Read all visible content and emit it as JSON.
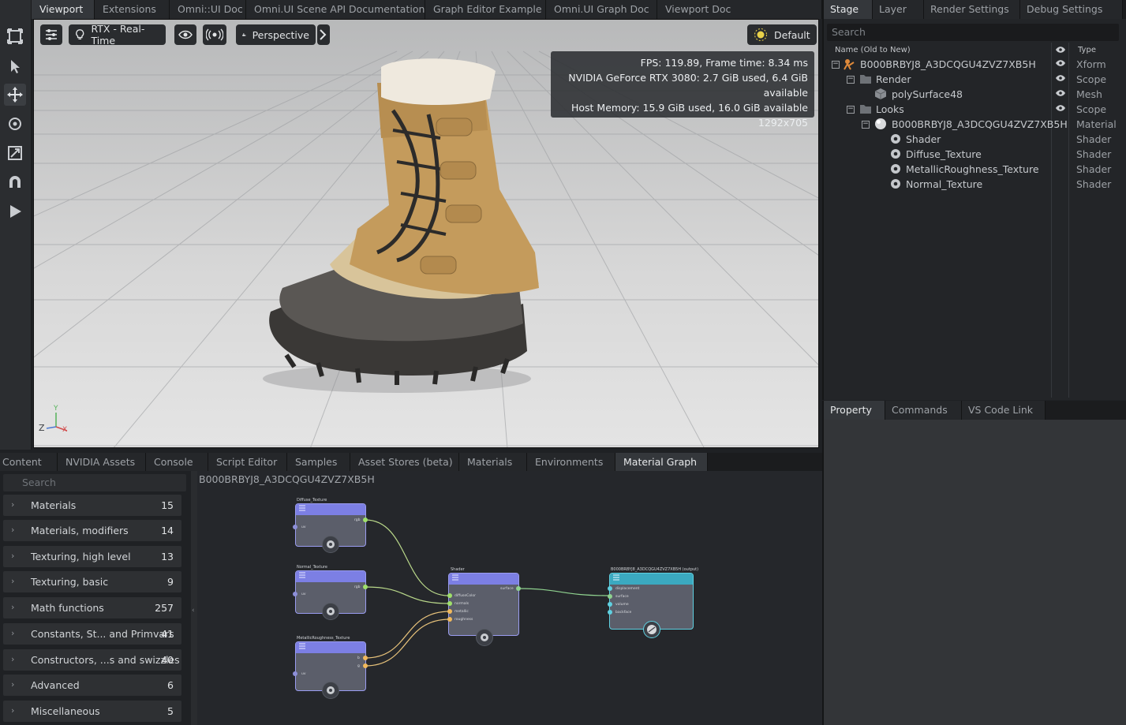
{
  "top_tabs": [
    "Viewport",
    "Extensions",
    "Omni::UI Doc",
    "Omni.UI Scene API Documentation",
    "Graph Editor Example",
    "Omni.UI Graph Doc",
    "Viewport Doc"
  ],
  "viewport": {
    "renderer_label": "RTX - Real-Time",
    "camera_label": "Perspective",
    "lighting_label": "Default",
    "hud": {
      "fps": "FPS: 119.89, Frame time: 8.34 ms",
      "gpu": "NVIDIA GeForce RTX 3080: 2.7 GiB used, 6.4 GiB available",
      "host": "Host Memory: 15.9 GiB used, 16.0 GiB available",
      "resolution": "1292x705"
    },
    "axis": {
      "y": "Y",
      "z": "Z",
      "x": "X"
    }
  },
  "right_tabs": [
    "Stage",
    "Layer",
    "Render Settings",
    "Debug Settings"
  ],
  "stage": {
    "search_placeholder": "Search",
    "col_name": "Name (Old to New)",
    "col_type": "Type",
    "rows": [
      {
        "name": "B000BRBYJ8_A3DCQGU4ZVZ7XB5H",
        "type": "Xform"
      },
      {
        "name": "Render",
        "type": "Scope"
      },
      {
        "name": "polySurface48",
        "type": "Mesh"
      },
      {
        "name": "Looks",
        "type": "Scope"
      },
      {
        "name": "B000BRBYJ8_A3DCQGU4ZVZ7XB5H",
        "type": "Material"
      },
      {
        "name": "Shader",
        "type": "Shader"
      },
      {
        "name": "Diffuse_Texture",
        "type": "Shader"
      },
      {
        "name": "MetallicRoughness_Texture",
        "type": "Shader"
      },
      {
        "name": "Normal_Texture",
        "type": "Shader"
      }
    ]
  },
  "prop_tabs": [
    "Property",
    "Commands",
    "VS Code Link"
  ],
  "bottom_tabs": [
    "Content",
    "NVIDIA Assets",
    "Console",
    "Script Editor",
    "Samples",
    "Asset Stores (beta)",
    "Materials",
    "Environments",
    "Material Graph"
  ],
  "library": {
    "search_placeholder": "Search",
    "items": [
      {
        "label": "Materials",
        "count": "15"
      },
      {
        "label": "Materials, modifiers",
        "count": "14"
      },
      {
        "label": "Texturing, high level",
        "count": "13"
      },
      {
        "label": "Texturing, basic",
        "count": "9"
      },
      {
        "label": "Math functions",
        "count": "257"
      },
      {
        "label": "Constants, St... and Primvars",
        "count": "41"
      },
      {
        "label": "Constructors, ...s and swizzles",
        "count": "40"
      },
      {
        "label": "Advanced",
        "count": "6"
      },
      {
        "label": "Miscellaneous",
        "count": "5"
      }
    ]
  },
  "graph": {
    "title": "B000BRBYJ8_A3DCQGU4ZVZ7XB5H",
    "nodes": {
      "diffuse": {
        "title": "Diffuse_Texture",
        "in": "uv",
        "out": "rgb"
      },
      "normal": {
        "title": "Normal_Texture",
        "in": "uv",
        "out": "rgb"
      },
      "metal": {
        "title": "MetallicRoughness_Texture",
        "in": "uv",
        "out1": "b",
        "out2": "g"
      },
      "shader": {
        "title": "Shader",
        "out": "surface",
        "in1": "diffuseColor",
        "in2": "normals",
        "in3": "metallic",
        "in4": "roughness"
      },
      "material": {
        "title": "B000BRBYJ8_A3DCQGU4ZVZ7XB5H (output)",
        "in1": "displacement",
        "in2": "surface",
        "in3": "volume",
        "in4": "backface"
      }
    }
  }
}
